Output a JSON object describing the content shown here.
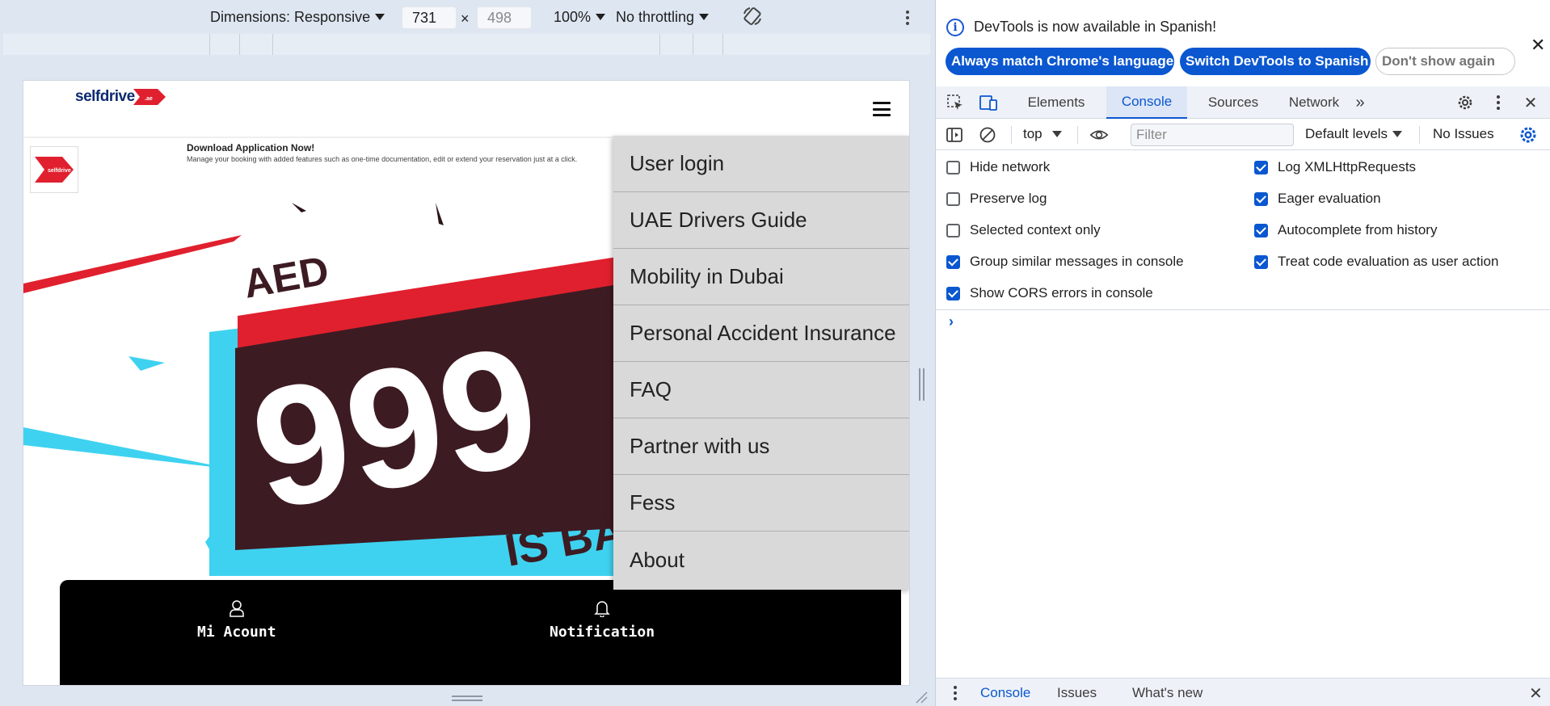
{
  "device_toolbar": {
    "dimensions_label": "Dimensions: Responsive",
    "width_value": "731",
    "height_value": "498",
    "zoom": "100%",
    "throttling": "No throttling",
    "rotate_icon": "rotate-icon",
    "more_icon": "more-vertical-icon"
  },
  "site": {
    "logo_text": "selfdrive",
    "logo_badge_text": ".ae",
    "app_banner": {
      "title": "Download Application Now!",
      "description": "Manage your booking with added features such as one-time documentation, edit or extend your reservation just at a click."
    },
    "hero": {
      "currency": "AED",
      "amount": "999",
      "tagline": "IS BA"
    },
    "menu": [
      "User login",
      "UAE Drivers Guide",
      "Mobility in Dubai",
      "Personal Accident Insurance",
      "FAQ",
      "Partner with us",
      "Fess",
      "About"
    ],
    "bottom_nav": {
      "account_label": "Mi Acount",
      "notification_label": "Notification"
    }
  },
  "devtools": {
    "infobar": {
      "message": "DevTools is now available in Spanish!",
      "btn_match": "Always match Chrome's language",
      "btn_switch": "Switch DevTools to Spanish",
      "btn_dismiss": "Don't show again"
    },
    "tabs": [
      "Elements",
      "Console",
      "Sources",
      "Network"
    ],
    "active_tab": "Console",
    "console_toolbar": {
      "context": "top",
      "filter_placeholder": "Filter",
      "levels": "Default levels",
      "issues": "No Issues"
    },
    "settings_left": [
      {
        "label": "Hide network",
        "checked": false
      },
      {
        "label": "Preserve log",
        "checked": false
      },
      {
        "label": "Selected context only",
        "checked": false
      },
      {
        "label": "Group similar messages in console",
        "checked": true
      },
      {
        "label": "Show CORS errors in console",
        "checked": true
      }
    ],
    "settings_right": [
      {
        "label": "Log XMLHttpRequests",
        "checked": true
      },
      {
        "label": "Eager evaluation",
        "checked": true
      },
      {
        "label": "Autocomplete from history",
        "checked": true
      },
      {
        "label": "Treat code evaluation as user action",
        "checked": true
      }
    ],
    "drawer_tabs": [
      "Console",
      "Issues",
      "What's new"
    ],
    "colors": {
      "accent": "#0b57d0",
      "brand_red": "#e0202e",
      "hero_dark": "#3d1b22",
      "hero_cyan": "#3ed2f0"
    }
  }
}
